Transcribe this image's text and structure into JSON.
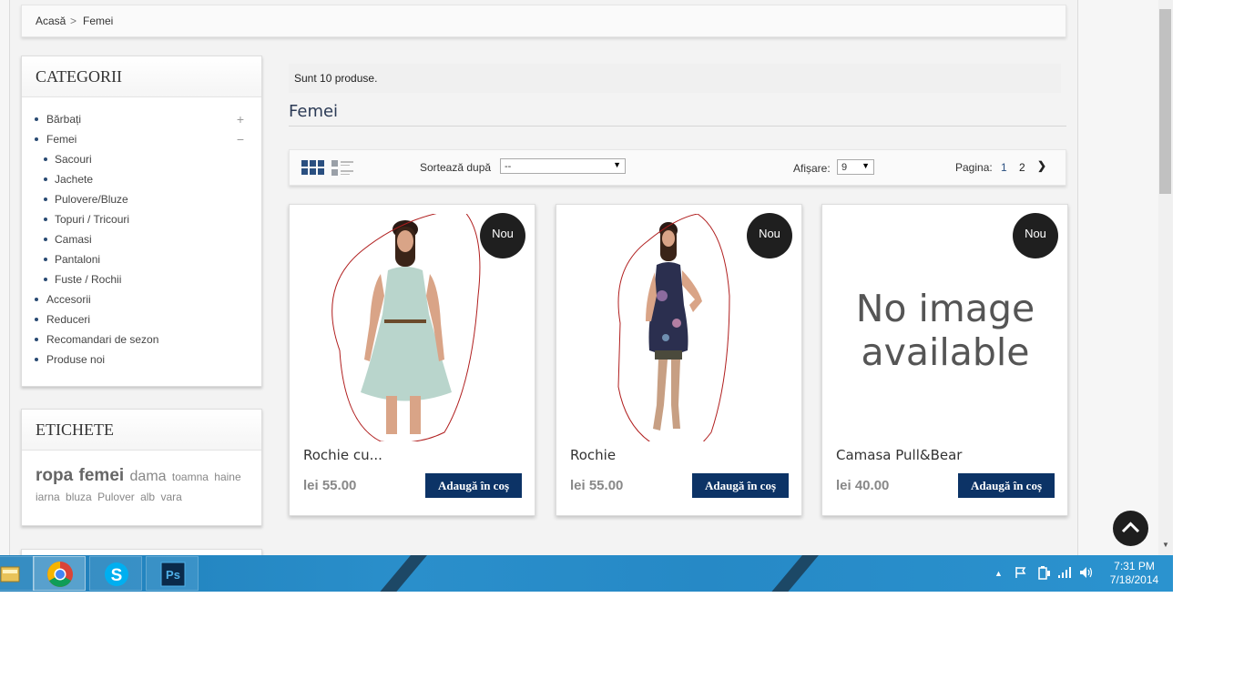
{
  "breadcrumb": {
    "home": "Acasă",
    "separator": ">",
    "current": "Femei"
  },
  "categories": {
    "title": "CATEGORII",
    "items": [
      {
        "label": "Bărbați",
        "toggle": "+",
        "sub": false
      },
      {
        "label": "Femei",
        "toggle": "−",
        "sub": false
      },
      {
        "label": "Sacouri",
        "sub": true
      },
      {
        "label": "Jachete",
        "sub": true
      },
      {
        "label": "Pulovere/Bluze",
        "sub": true
      },
      {
        "label": "Topuri / Tricouri",
        "sub": true
      },
      {
        "label": "Camasi",
        "sub": true
      },
      {
        "label": "Pantaloni",
        "sub": true
      },
      {
        "label": "Fuste / Rochii",
        "sub": true
      },
      {
        "label": "Accesorii",
        "sub": false
      },
      {
        "label": "Reduceri",
        "sub": false
      },
      {
        "label": "Recomandari de sezon",
        "sub": false
      },
      {
        "label": "Produse noi",
        "sub": false
      }
    ]
  },
  "tags": {
    "title": "ETICHETE",
    "items": [
      "ropa",
      "femei",
      "dama",
      "toamna",
      "haine",
      "iarna",
      "bluza",
      "Pulover",
      "alb",
      "vara"
    ]
  },
  "listing": {
    "count_text": "Sunt 10 produse.",
    "heading": "Femei",
    "sort_label": "Sortează după",
    "sort_value": "--",
    "show_label": "Afișare:",
    "show_value": "9",
    "page_label": "Pagina:",
    "pages": [
      "1",
      "2"
    ],
    "next_icon": "chevron-right-icon"
  },
  "products": [
    {
      "name": "Rochie cu...",
      "price": "lei 55.00",
      "badge": "Nou",
      "button": "Adaugă în coș",
      "image": "light-blue-dress-photo"
    },
    {
      "name": "Rochie",
      "price": "lei 55.00",
      "badge": "Nou",
      "button": "Adaugă în coș",
      "image": "dark-floral-dress-photo"
    },
    {
      "name": "Camasa Pull&Bear",
      "price": "lei 40.00",
      "badge": "Nou",
      "button": "Adaugă în coș",
      "image": "No image available"
    }
  ],
  "taskbar": {
    "apps": [
      "file-explorer-icon",
      "chrome-icon",
      "skype-icon",
      "photoshop-icon"
    ],
    "photoshop_label": "Ps",
    "skype_label": "S",
    "time": "7:31 PM",
    "date": "7/18/2014"
  },
  "colors": {
    "accent": "#0c3366",
    "badge": "#1f1f1f",
    "taskbar": "#2689c6"
  }
}
